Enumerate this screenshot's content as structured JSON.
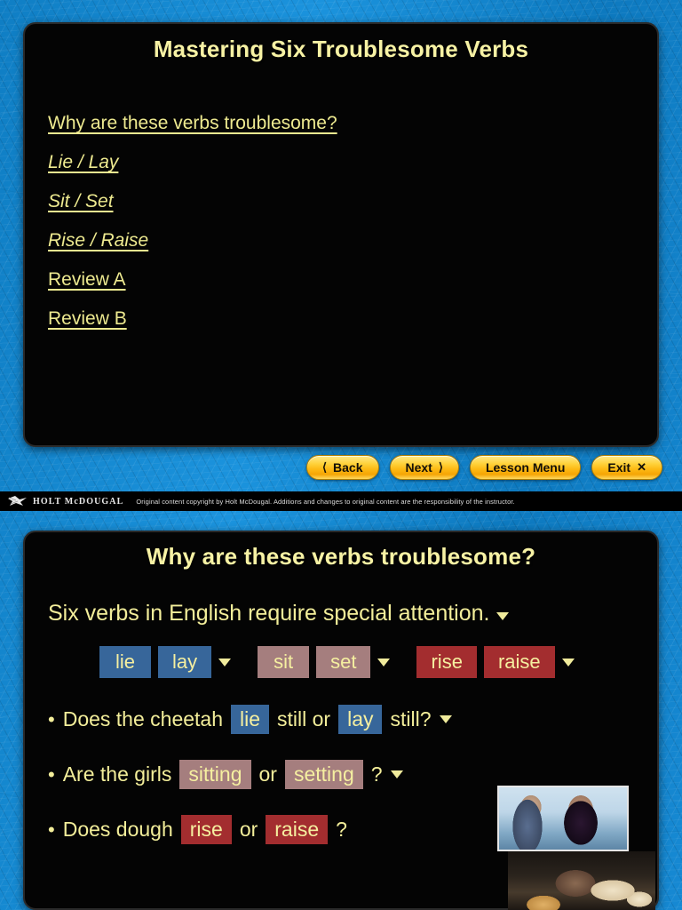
{
  "slide_one": {
    "title": "Mastering Six Troublesome Verbs",
    "links": [
      {
        "label": "Why are these verbs troublesome?",
        "italic": false
      },
      {
        "label": "Lie / Lay",
        "italic": true
      },
      {
        "label": "Sit / Set",
        "italic": true
      },
      {
        "label": "Rise / Raise",
        "italic": true
      },
      {
        "label": "Review A",
        "italic": false
      },
      {
        "label": "Review B",
        "italic": false
      }
    ]
  },
  "nav": {
    "back_label": "Back",
    "back_icon": "chevron-left-icon",
    "next_label": "Next",
    "next_icon": "chevron-right-icon",
    "lesson_menu_label": "Lesson Menu",
    "exit_label": "Exit",
    "exit_icon": "close-x-icon"
  },
  "footer": {
    "logo_icon": "eagle-logo-icon",
    "brand": "HOLT McDOUGAL",
    "copyright": "Original content copyright by Holt McDougal.  Additions and changes to original content are the responsibility of the instructor."
  },
  "slide_two": {
    "title": "Why are these verbs troublesome?",
    "lead": "Six verbs in English require special attention.",
    "lead_marker": "triangle-down-icon",
    "verb_chips": [
      {
        "label": "lie",
        "color_class": "blue"
      },
      {
        "label": "lay",
        "color_class": "blue"
      },
      {
        "label": "sit",
        "color_class": "rose"
      },
      {
        "label": "set",
        "color_class": "rose"
      },
      {
        "label": "rise",
        "color_class": "red"
      },
      {
        "label": "raise",
        "color_class": "red"
      }
    ],
    "bullets": [
      {
        "bullet": "•",
        "pre": "Does the cheetah",
        "word1": "lie",
        "mid": "still or",
        "word2": "lay",
        "post": "still?",
        "color_class": "blue"
      },
      {
        "bullet": "•",
        "pre": "Are the girls",
        "word1": "sitting",
        "mid": "or",
        "word2": "setting",
        "post": "?",
        "color_class": "rose"
      },
      {
        "bullet": "•",
        "pre": "Does dough",
        "word1": "rise",
        "mid": "or",
        "word2": "raise",
        "post": "?",
        "color_class": "red"
      }
    ],
    "photos": [
      {
        "name": "photo-girls-talking",
        "alt": "Two girls talking"
      },
      {
        "name": "photo-kneading-dough",
        "alt": "Hands kneading dough"
      }
    ]
  },
  "colors": {
    "background_blue": "#1689d3",
    "slide_black": "#040404",
    "title_yellow": "#f7f2a4",
    "body_yellow": "#f3ee9a",
    "chip_blue": "#37669a",
    "chip_rose": "#a57e7e",
    "chip_red": "#a32d2f",
    "button_gold": "#fdb913"
  }
}
